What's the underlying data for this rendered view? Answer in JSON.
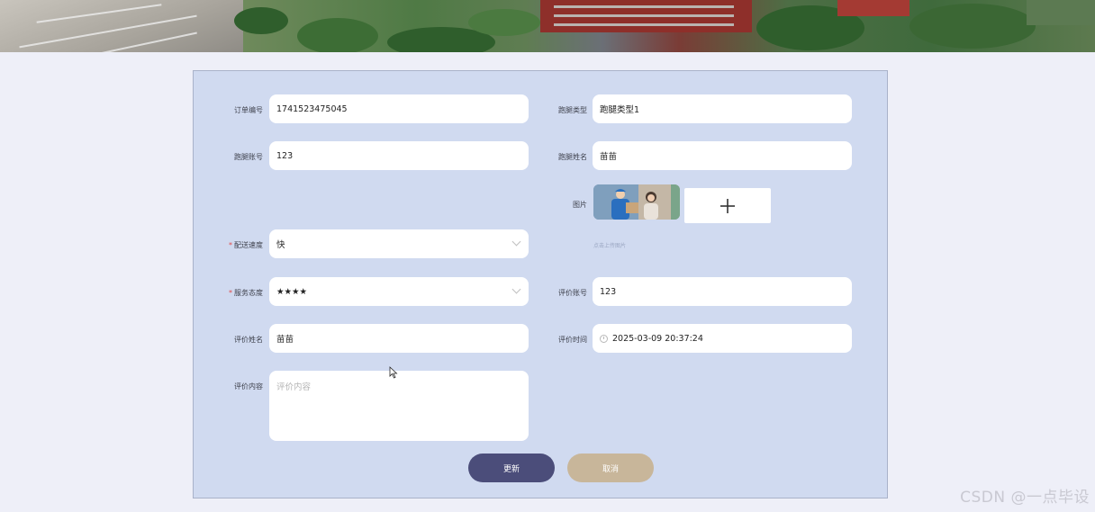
{
  "form": {
    "order_no": {
      "label": "订单编号",
      "value": "1741523475045"
    },
    "runner_type": {
      "label": "跑腿类型",
      "value": "跑腿类型1"
    },
    "runner_account": {
      "label": "跑腿账号",
      "value": "123"
    },
    "runner_name": {
      "label": "跑腿姓名",
      "value": "苗苗"
    },
    "image": {
      "label": "图片",
      "hint": "点击上传图片"
    },
    "delivery_speed": {
      "label": "配送速度",
      "value": "快",
      "required": true
    },
    "service_attitude": {
      "label": "服务态度",
      "value": "★★★★",
      "required": true
    },
    "reviewer_account": {
      "label": "评价账号",
      "value": "123"
    },
    "reviewer_name": {
      "label": "评价姓名",
      "value": "苗苗"
    },
    "review_time": {
      "label": "评价时间",
      "value": "2025-03-09 20:37:24"
    },
    "review_content": {
      "label": "评价内容",
      "placeholder": "评价内容"
    }
  },
  "buttons": {
    "update": "更新",
    "cancel": "取消"
  },
  "watermark": "CSDN @一点毕设",
  "colors": {
    "page_bg": "#eeeff8",
    "card_bg": "#d0daf0",
    "update_button": "#4b4d7a",
    "cancel_button": "#c8b69a",
    "required_mark": "#e04c4c"
  },
  "icons": [
    "chevron-down-icon",
    "clock-icon",
    "plus-icon",
    "cursor-icon"
  ]
}
